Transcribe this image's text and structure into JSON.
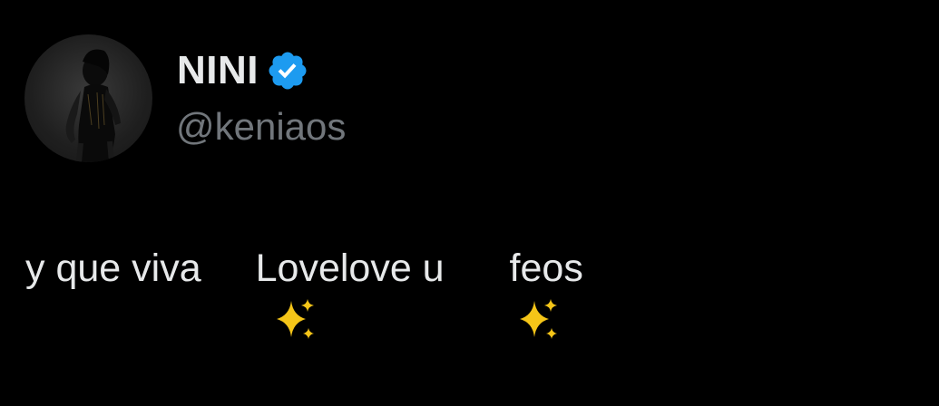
{
  "author": {
    "display_name": "NINI",
    "handle": "@keniaos",
    "verified": true,
    "avatar_icon": "profile-photo"
  },
  "tweet": {
    "text_part1": "y que viva",
    "sparkles_icon_1": "sparkles-emoji",
    "text_part2": "Lovelove u",
    "sparkles_icon_2": "sparkles-emoji",
    "text_part3": " feos"
  },
  "colors": {
    "background": "#000000",
    "name": "#e7e9ea",
    "handle": "#71767b",
    "verified_blue": "#1d9bf0",
    "sparkle_gold": "#f5c518"
  }
}
